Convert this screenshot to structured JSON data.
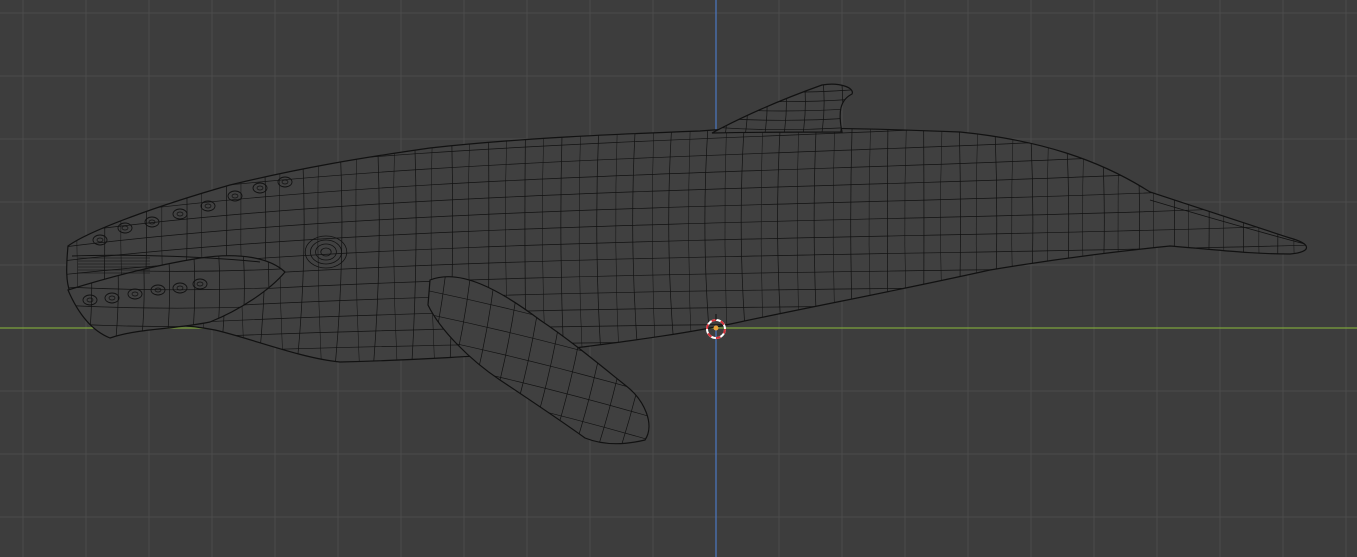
{
  "viewport": {
    "view": "orthographic-side",
    "shading": "wireframe",
    "object": "humpback-whale-mesh"
  },
  "colors": {
    "background": "#3d3d3d",
    "grid": "#4b4b4b",
    "x_axis": "#7da33c",
    "z_axis": "#4a73b8",
    "wire": "#111111",
    "mesh_fill": "#404040",
    "cursor_red": "#d6313a",
    "cursor_white": "#ffffff",
    "origin": "#e8a23a"
  },
  "icons": {
    "cursor": "3d-cursor-icon",
    "origin": "object-origin-icon"
  }
}
